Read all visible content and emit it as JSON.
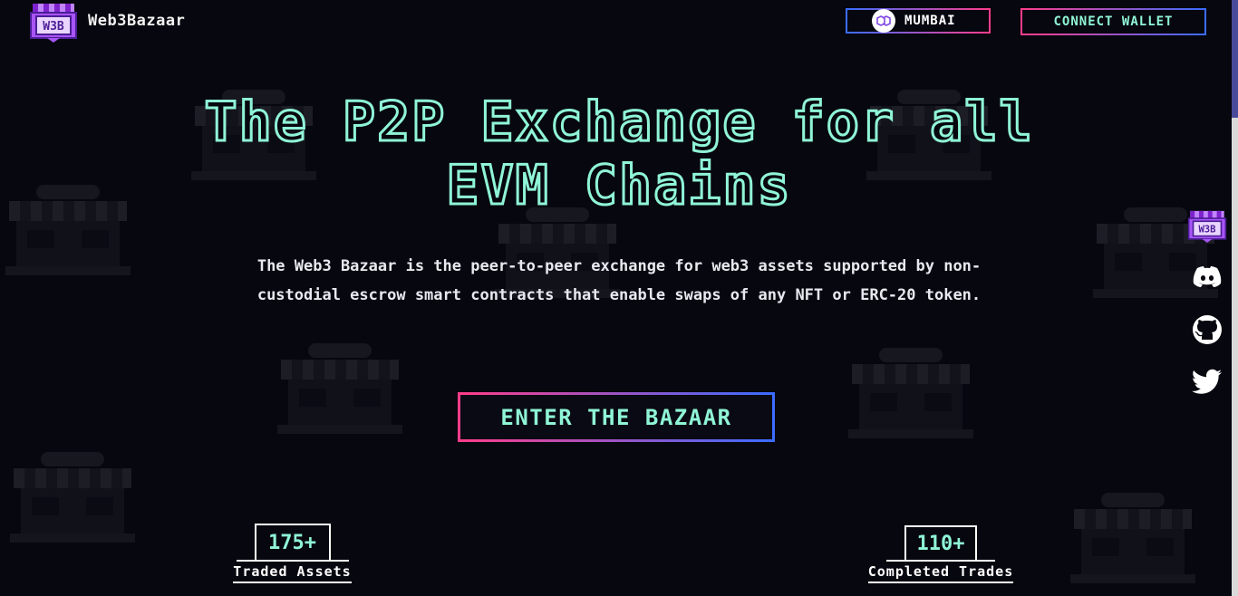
{
  "header": {
    "brand": "Web3Bazaar",
    "logo_text": "W3B",
    "network_label": "MUMBAI",
    "network_icon": "polygon-icon",
    "connect_wallet_label": "CONNECT WALLET"
  },
  "hero": {
    "title_line1": "The P2P Exchange for all",
    "title_line2": "EVM Chains",
    "description": "The Web3 Bazaar is the peer-to-peer exchange for web3 assets supported by non-custodial escrow smart contracts that enable swaps of any NFT or ERC-20 token.",
    "enter_button_label": "ENTER THE BAZAAR"
  },
  "stats": [
    {
      "value": "175+",
      "label": "Traded Assets"
    },
    {
      "value": "110+",
      "label": "Completed Trades"
    }
  ],
  "social": [
    {
      "name": "w3b-logo-icon"
    },
    {
      "name": "discord-icon"
    },
    {
      "name": "github-icon"
    },
    {
      "name": "twitter-icon"
    }
  ],
  "colors": {
    "background": "#07070f",
    "accent_mint": "#8ff5d6",
    "accent_pink": "#ff3d8b",
    "accent_blue": "#3b6cff",
    "logo_purple": "#a855f7"
  }
}
